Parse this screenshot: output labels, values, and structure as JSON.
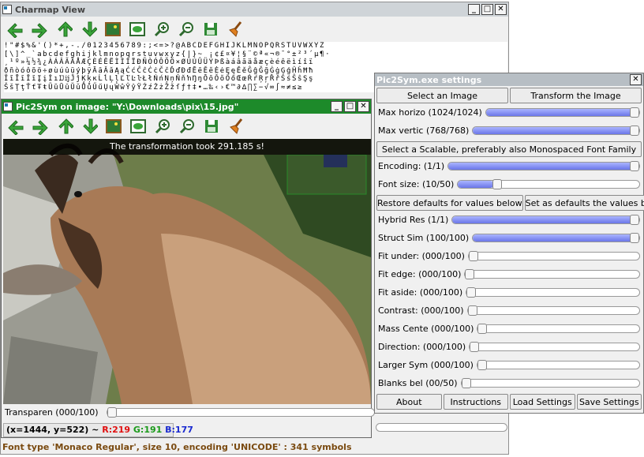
{
  "charmap": {
    "title": "Charmap View",
    "grid_rows": [
      "!\"#$%&'()*+,-./0123456789:;<=>?@ABCDEFGHIJKLMNOPQRSTUVWXYZ",
      "[\\]^_`abcdefghijklmnopqrstuvwxyz{|}~ ¡¢£¤¥¦§¨©ª«¬­®¯°±²³´µ¶·",
      "¸¹º»¼½¾¿ÀÁÂÃÄÅÆÇÈÉÊËÌÍÎÏÐÑÒÓÔÕÖ×ØÙÚÛÜÝÞßàáâãäåæçèéêëìíîï",
      "ðñòóôõö÷øùúûüýþÿĀāĂăĄąĆćĈĉĊċČčĎďĐđĒēĔĕĖėĘęĚěĜĝĞğĠġĢģĤĥĦħ",
      "ĨĩĪīĬĭĮįİıĲĳĴĵĶķĸĹĺĻļĽľĿŀŁłŃńŅņŇňŉŊŋŌōŎŏŐőŒœŔŕŖŗŘřŚśŜŝŞş",
      "ŠšŢţŤťŦŧŨũŪūŬŭŮůŰűŲųŴŵŶŷŸŹźŻżŽžſƒ†‡•…‰‹›€™∂∆∏∑−√∞∫≈≠≤≥"
    ],
    "status": "Font type 'Monaco Regular', size 10, encoding 'UNICODE' : 341 symbols"
  },
  "toolbar_icons": [
    "arrow-left-icon",
    "arrow-right-icon",
    "arrow-up-icon",
    "arrow-down-icon",
    "image-icon",
    "eye-icon",
    "zoom-in-icon",
    "zoom-out-icon",
    "save-icon",
    "broom-icon"
  ],
  "imgwin": {
    "title": "Pic2Sym on image: \"Y:\\Downloads\\pix\\15.jpg\"",
    "overlay": "The transformation took 291.185 s!",
    "transparency_label": "Transparen (000/100)",
    "transparency_value": 0,
    "coord_prefix": "(x=1444, y=522) ~ ",
    "r": "R:219",
    "g": "G:191",
    "b": "B:177"
  },
  "settings": {
    "title": "Pic2Sym.exe settings",
    "select_image": "Select an Image",
    "transform_image": "Transform the Image",
    "select_font": "Select a Scalable, preferably also Monospaced Font Family",
    "restore_defaults": "Restore defaults for values below",
    "set_defaults": "Set as defaults the values below",
    "about": "About",
    "instructions": "Instructions",
    "load_settings": "Load Settings",
    "save_settings": "Save Settings",
    "sliders_top": [
      {
        "label": "Max horizo (1024/1024)",
        "value": 1.0
      },
      {
        "label": "Max vertic (768/768)",
        "value": 1.0
      }
    ],
    "sliders_font": [
      {
        "label": "Encoding:  (1/1)",
        "value": 1.0
      },
      {
        "label": "Font size: (10/50)",
        "value": 0.2
      }
    ],
    "sliders_match": [
      {
        "label": "Hybrid Res (1/1)",
        "value": 1.0
      },
      {
        "label": "Struct Sim (100/100)",
        "value": 1.0
      },
      {
        "label": "Fit under: (000/100)",
        "value": 0
      },
      {
        "label": "Fit edge:  (000/100)",
        "value": 0
      },
      {
        "label": "Fit aside: (000/100)",
        "value": 0
      },
      {
        "label": "Contrast:  (000/100)",
        "value": 0
      },
      {
        "label": "Mass Cente (000/100)",
        "value": 0
      },
      {
        "label": "Direction: (000/100)",
        "value": 0
      },
      {
        "label": "Larger Sym (000/100)",
        "value": 0
      },
      {
        "label": "Blanks bel (00/50)",
        "value": 0
      }
    ]
  },
  "colors": {
    "title_green": "#1d8a2a",
    "slider_fill": "#6a76e8",
    "r": "#e01010",
    "g": "#1a9a1a",
    "b": "#1a2ad0"
  }
}
